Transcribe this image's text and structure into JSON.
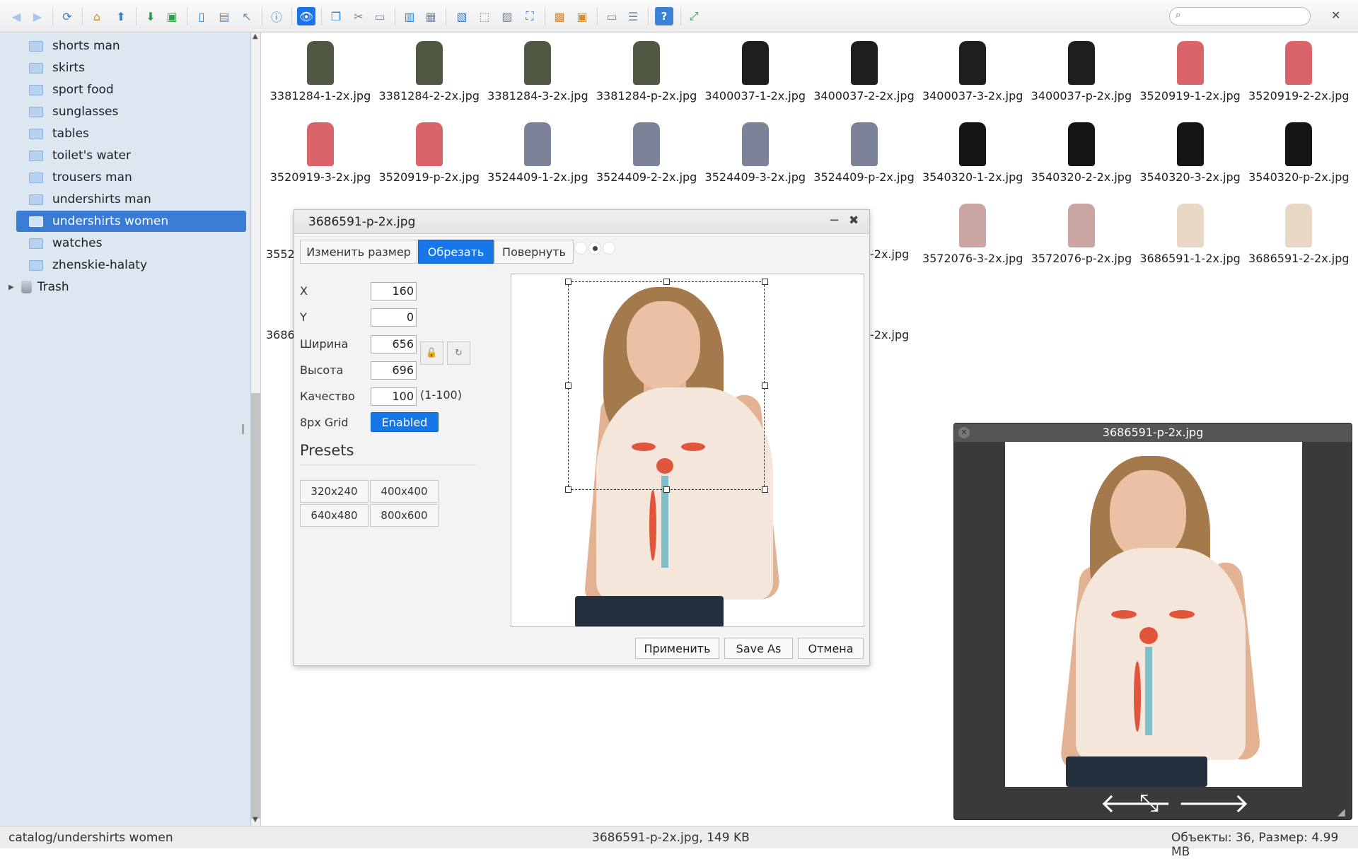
{
  "toolbar": {
    "search_placeholder": "",
    "close_symbol": "✕"
  },
  "sidebar": {
    "folders": [
      {
        "label": "shorts man"
      },
      {
        "label": "skirts"
      },
      {
        "label": "sport food"
      },
      {
        "label": "sunglasses"
      },
      {
        "label": "tables"
      },
      {
        "label": "toilet's water"
      },
      {
        "label": "trousers man"
      },
      {
        "label": "undershirts man"
      },
      {
        "label": "undershirts women",
        "selected": true
      },
      {
        "label": "watches"
      },
      {
        "label": "zhenskie-halaty"
      }
    ],
    "trash_label": "Trash"
  },
  "files": {
    "row1": [
      "3381284-1-2x.jpg",
      "3381284-2-2x.jpg",
      "3381284-3-2x.jpg",
      "3381284-p-2x.jpg",
      "3400037-1-2x.jpg",
      "3400037-2-2x.jpg",
      "3400037-3-2x.jpg",
      "3400037-p-2x.jpg",
      "3520919-1-2x.jpg",
      "3520919-2-2x.jpg"
    ],
    "row2": [
      "3520919-3-2x.jpg",
      "3520919-p-2x.jpg",
      "3524409-1-2x.jpg",
      "3524409-2-2x.jpg",
      "3524409-3-2x.jpg",
      "3524409-p-2x.jpg",
      "3540320-1-2x.jpg",
      "3540320-2-2x.jpg",
      "3540320-3-2x.jpg",
      "3540320-p-2x.jpg"
    ],
    "row3_left": "3552",
    "row3_partial": "-2x.jpg",
    "row3": [
      "3572076-3-2x.jpg",
      "3572076-p-2x.jpg",
      "3686591-1-2x.jpg",
      "3686591-2-2x.jpg"
    ],
    "row4_left": "3686",
    "row4_partial": "-2x.jpg"
  },
  "dialog": {
    "title": "3686591-p-2x.jpg",
    "min_symbol": "−",
    "close_symbol": "✖",
    "tabs": [
      "Изменить размер",
      "Обрезать",
      "Повернуть"
    ],
    "labels": {
      "x": "X",
      "y": "Y",
      "width": "Ширина",
      "height": "Высота",
      "quality": "Качество",
      "grid": "8px Grid"
    },
    "values": {
      "x": "160",
      "y": "0",
      "width": "656",
      "height": "696",
      "quality": "100"
    },
    "quality_range": "(1-100)",
    "grid_button": "Enabled",
    "presets_title": "Presets",
    "presets": [
      "320x240",
      "400x400",
      "640x480",
      "800x600"
    ],
    "buttons": {
      "apply": "Применить",
      "save_as": "Save As",
      "cancel": "Отмена"
    }
  },
  "preview": {
    "title": "3686591-p-2x.jpg",
    "prev_symbol": "🡐",
    "next_symbol": "🡒",
    "fullscreen_symbol": "⤡"
  },
  "status": {
    "path": "catalog/undershirts women",
    "file": "3686591-p-2x.jpg, 149 KB",
    "stats": "Объекты: 36, Размер: 4.99 MB"
  }
}
